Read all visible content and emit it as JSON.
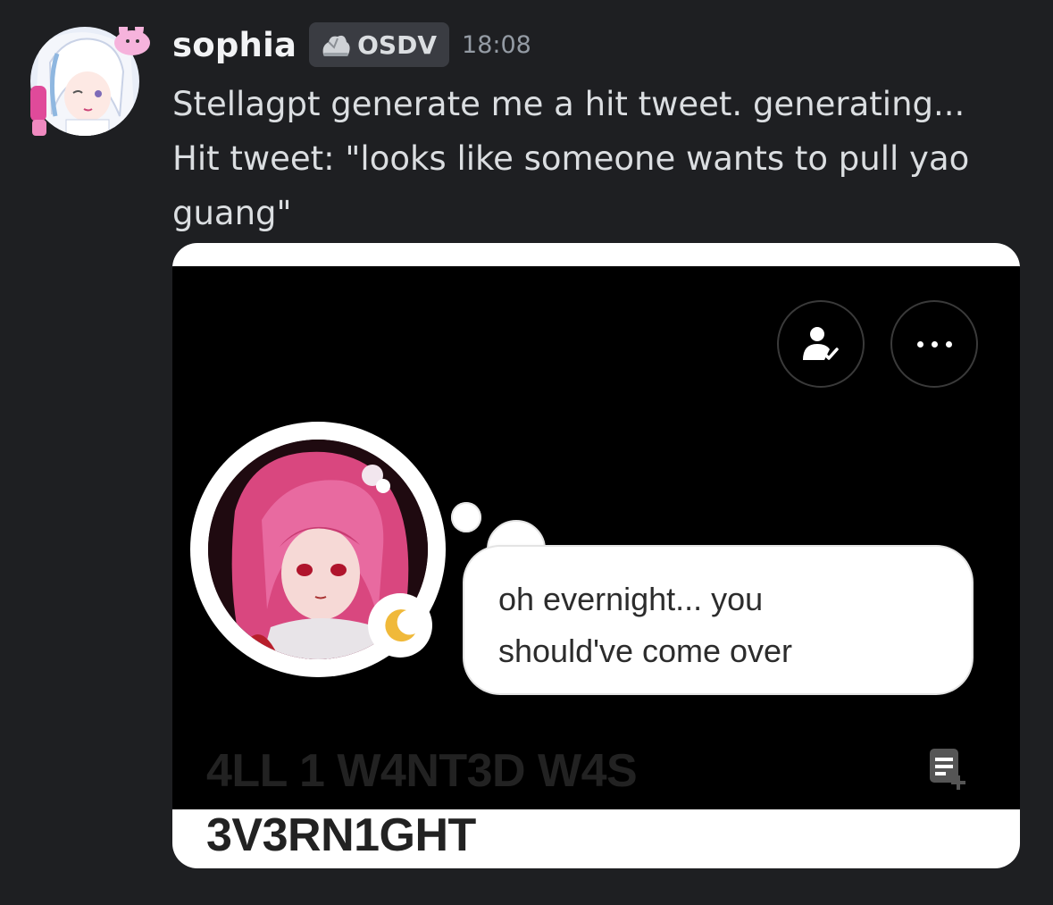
{
  "message": {
    "username": "sophia",
    "tag": {
      "icon": "guild-tag-icon",
      "label": "OSDV"
    },
    "timestamp": "18:08",
    "lines": [
      "Stellagpt generate me a hit tweet. generating...",
      "Hit tweet: \"looks like someone wants to pull yao",
      "guang\""
    ]
  },
  "attachment": {
    "buttons": {
      "follow": "follow-user-icon",
      "more": "more-options-icon"
    },
    "status_bubble": [
      "oh evernight... you",
      "should've come over"
    ],
    "display_name": [
      "4LL 1 W4NT3D W4S",
      "3V3RN1GHT"
    ],
    "badge_icon": "crescent-moon-icon",
    "note_icon": "add-note-icon"
  },
  "colors": {
    "background": "#1e1f22",
    "username": "#f2f3f5",
    "message_text": "#dbdee1",
    "timestamp": "#949ba4",
    "moon": "#f0b93a"
  }
}
